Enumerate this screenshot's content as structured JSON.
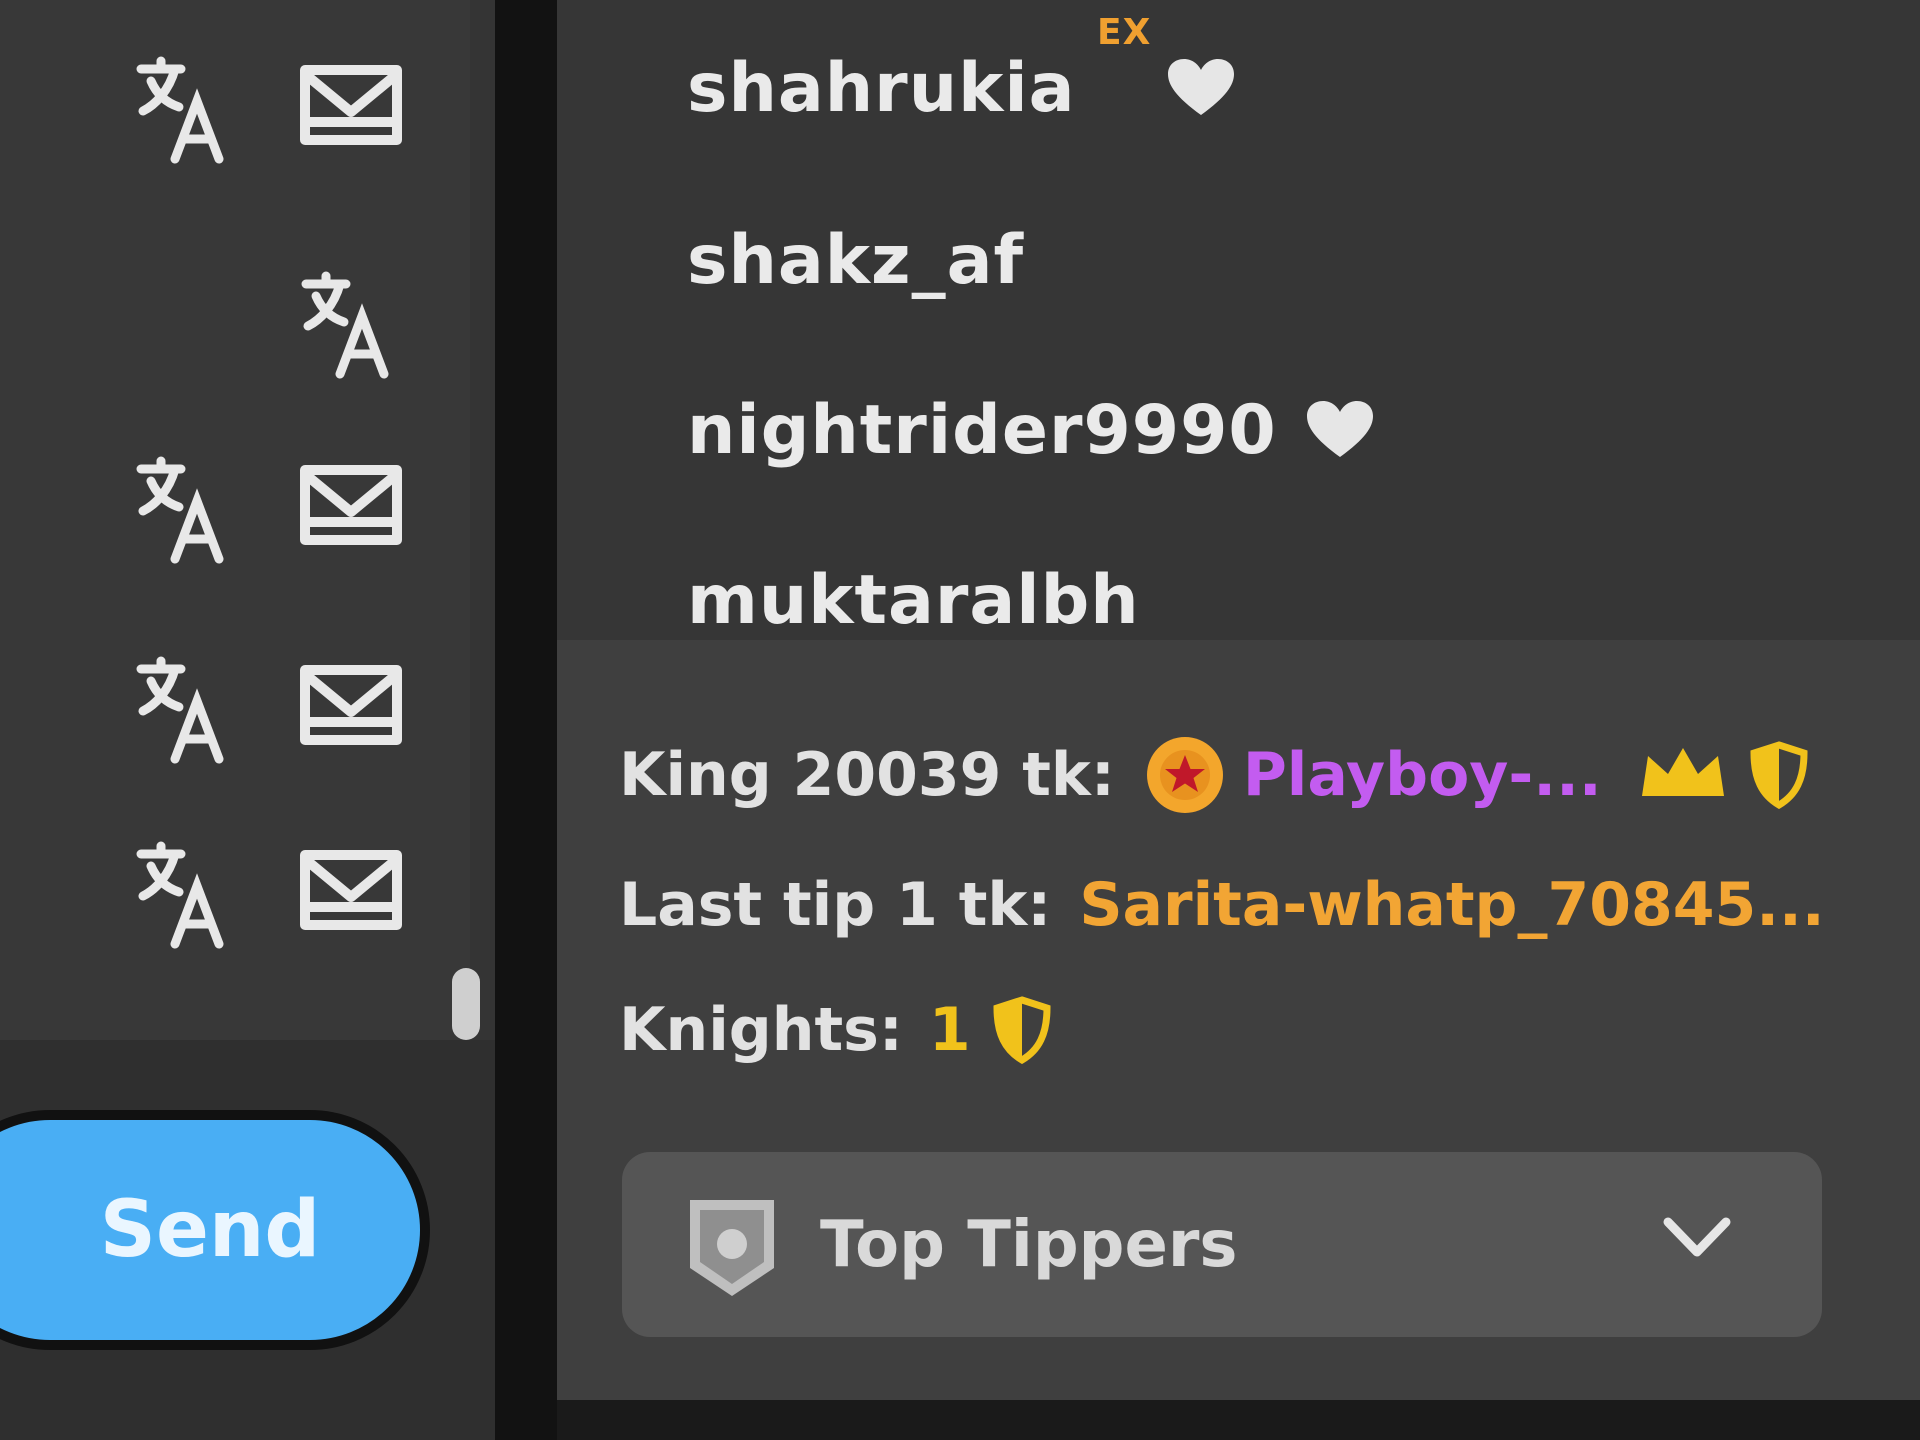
{
  "chat": {
    "rows": [
      {
        "icons": [
          "translate-icon",
          "dm-icon"
        ]
      },
      {
        "icons": [
          "translate-icon"
        ]
      },
      {
        "icons": [
          "translate-icon",
          "dm-icon"
        ]
      },
      {
        "icons": [
          "translate-icon",
          "dm-icon"
        ]
      },
      {
        "icons": [
          "translate-icon",
          "dm-icon"
        ]
      }
    ]
  },
  "composer": {
    "send_label": "Send",
    "send_color": "#49aef4"
  },
  "users": [
    {
      "name": "shahrukia",
      "badge": "EX",
      "icon": "heart-icon"
    },
    {
      "name": "shakz_af"
    },
    {
      "name": "nightrider9990",
      "icon": "heart-icon"
    },
    {
      "name": "muktaralbh"
    }
  ],
  "info": {
    "king_prefix": "King 20039 tk:",
    "king_name": "Playboy-...",
    "last_tip_prefix": "Last tip 1 tk:",
    "last_tip_name": "Sarita-whatp_70845...",
    "knights_prefix": "Knights:",
    "knights_count": "1"
  },
  "top_tippers": {
    "label": "Top Tippers",
    "icon": "trophy-icon",
    "toggle_icon": "chevron-down-icon"
  },
  "colors": {
    "king_name": "#c35cf0",
    "last_tip_name": "#f2a534",
    "knight_yellow": "#f1c21b"
  }
}
